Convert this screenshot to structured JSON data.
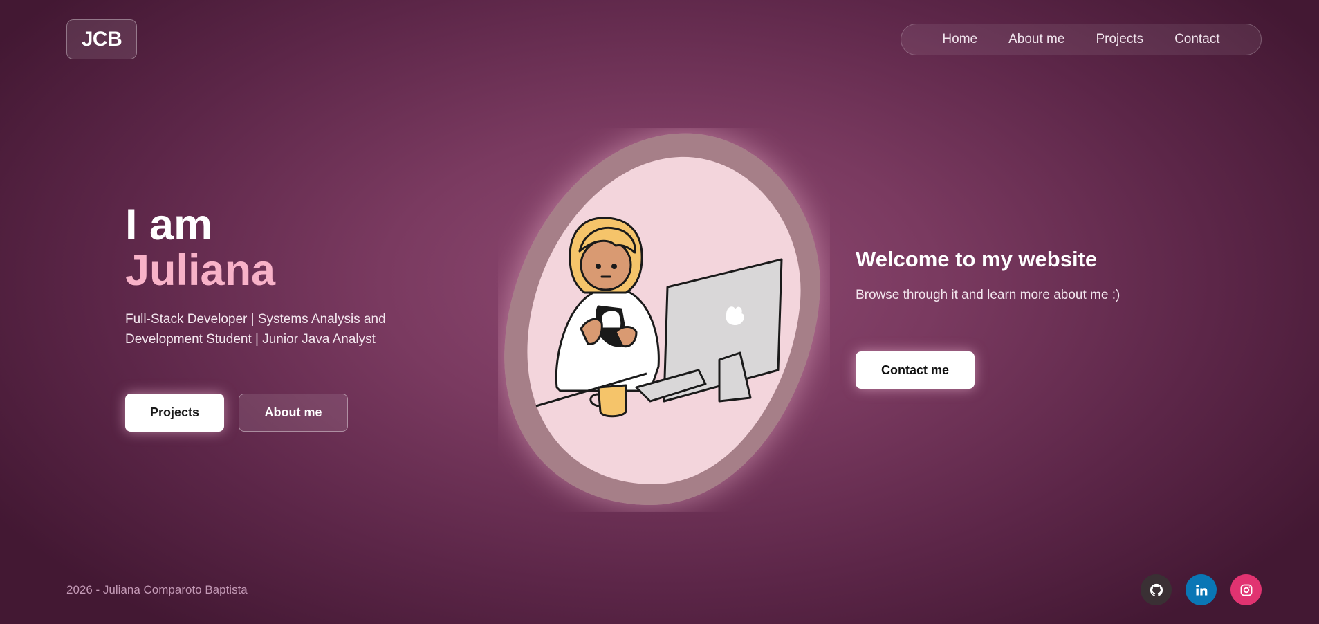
{
  "header": {
    "logo": "JCB",
    "nav": [
      "Home",
      "About me",
      "Projects",
      "Contact"
    ]
  },
  "hero": {
    "line1": "I am",
    "name": "Juliana",
    "subtitle": "Full-Stack Developer | Systems Analysis and Development Student | Junior Java Analyst",
    "buttons": {
      "primary": "Projects",
      "secondary": "About me"
    }
  },
  "welcome": {
    "title": "Welcome to my website",
    "text": "Browse through it and learn more about me :)",
    "button": "Contact me"
  },
  "footer": {
    "text": "2026 - Juliana Comparoto Baptista",
    "socials": [
      "github-icon",
      "linkedin-icon",
      "instagram-icon"
    ]
  },
  "colors": {
    "accent_pink": "#f8b2c8",
    "github": "#3a3034",
    "linkedin": "#0a76b5",
    "instagram": "#e13371"
  }
}
